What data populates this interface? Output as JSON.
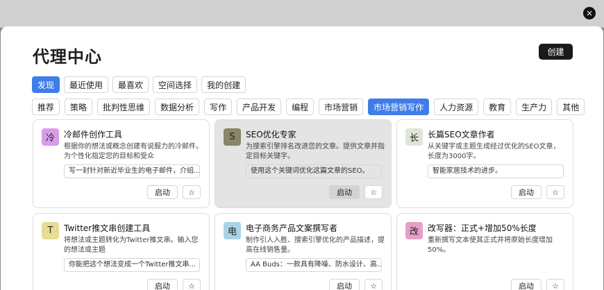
{
  "colors": {
    "accent": "#3f7de8",
    "dark_button": "#1a1a1a"
  },
  "close_icon": "×",
  "title": "代理中心",
  "create_label": "创建",
  "primary_tabs": [
    {
      "label": "发现",
      "active": true
    },
    {
      "label": "最近使用",
      "active": false
    },
    {
      "label": "最喜欢",
      "active": false
    },
    {
      "label": "空间选择",
      "active": false
    },
    {
      "label": "我的创建",
      "active": false
    }
  ],
  "categories": [
    {
      "label": "推荐",
      "active": false
    },
    {
      "label": "策略",
      "active": false
    },
    {
      "label": "批判性思维",
      "active": false
    },
    {
      "label": "数据分析",
      "active": false
    },
    {
      "label": "写作",
      "active": false
    },
    {
      "label": "产品开发",
      "active": false
    },
    {
      "label": "编程",
      "active": false
    },
    {
      "label": "市场营销",
      "active": false
    },
    {
      "label": "市场营销写作",
      "active": true
    },
    {
      "label": "人力资源",
      "active": false
    },
    {
      "label": "教育",
      "active": false
    },
    {
      "label": "生产力",
      "active": false
    },
    {
      "label": "其他",
      "active": false
    }
  ],
  "cards": [
    {
      "icon": "冷",
      "icon_bg": "#d99be8",
      "title": "冷邮件创作工具",
      "desc": "根据你的想法或概念创建有说服力的冷邮件。为个性化指定您的目标和受众",
      "input": "写一封针对新近毕业生的电子邮件，介绍...",
      "start": "启动",
      "star": "☆",
      "highlight": false
    },
    {
      "icon": "S",
      "icon_bg": "#8a8468",
      "title": "SEO优化专家",
      "desc": "为搜索引擎排名改进您的文章。提供文章并指定目标关键字。",
      "input": "使用这个关键词优化这篇文章的SEO。",
      "start": "启动",
      "star": "☆",
      "highlight": true
    },
    {
      "icon": "长",
      "icon_bg": "#dfe6d8",
      "title": "长篇SEO文章作者",
      "desc": "从关键字或主题生成经过优化的SEO文章，长度为3000字。",
      "input": "智能家居技术的进步。",
      "start": "启动",
      "star": "☆",
      "highlight": false
    },
    {
      "icon": "T",
      "icon_bg": "#e8dc94",
      "title": "Twitter推文串创建工具",
      "desc": "将想法或主题转化为Twitter推文串。输入您的想法或主题",
      "input": "你能把这个想法变成一个Twitter推文串...",
      "start": "启动",
      "star": "☆",
      "highlight": false
    },
    {
      "icon": "电",
      "icon_bg": "#a8d4e4",
      "title": "电子商务产品文案撰写者",
      "desc": "制作引人入胜、搜索引擎优化的产品描述，提高在线销售量。",
      "input": "AA Buds：一款具有降噪、防水设计、高...",
      "start": "启动",
      "star": "☆",
      "highlight": false
    },
    {
      "icon": "改",
      "icon_bg": "#e4a0c8",
      "title": "改写器：正式+增加50%长度",
      "desc": "重新撰写文本使其正式并将原始长度增加50%。",
      "input": "",
      "start": "启动",
      "star": "☆",
      "highlight": false
    }
  ]
}
